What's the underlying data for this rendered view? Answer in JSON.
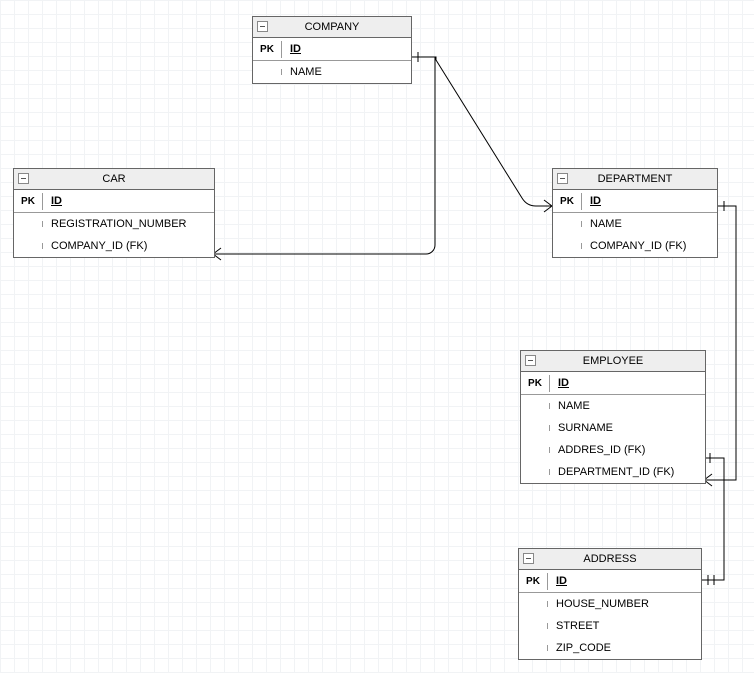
{
  "entities": {
    "company": {
      "title": "COMPANY",
      "pk_label": "PK",
      "pk_field": "ID",
      "fields": [
        "NAME"
      ]
    },
    "car": {
      "title": "CAR",
      "pk_label": "PK",
      "pk_field": "ID",
      "fields": [
        "REGISTRATION_NUMBER",
        "COMPANY_ID (FK)"
      ]
    },
    "department": {
      "title": "DEPARTMENT",
      "pk_label": "PK",
      "pk_field": "ID",
      "fields": [
        "NAME",
        "COMPANY_ID (FK)"
      ]
    },
    "employee": {
      "title": "EMPLOYEE",
      "pk_label": "PK",
      "pk_field": "ID",
      "fields": [
        "NAME",
        "SURNAME",
        "ADDRES_ID (FK)",
        "DEPARTMENT_ID (FK)"
      ]
    },
    "address": {
      "title": "ADDRESS",
      "pk_label": "PK",
      "pk_field": "ID",
      "fields": [
        "HOUSE_NUMBER",
        "STREET",
        "ZIP_CODE"
      ]
    }
  },
  "relationships": [
    {
      "from": "company",
      "to": "car",
      "type": "one-to-many"
    },
    {
      "from": "company",
      "to": "department",
      "type": "one-to-many"
    },
    {
      "from": "department",
      "to": "employee",
      "type": "one-to-many"
    },
    {
      "from": "address",
      "to": "employee",
      "type": "one-to-one"
    }
  ]
}
